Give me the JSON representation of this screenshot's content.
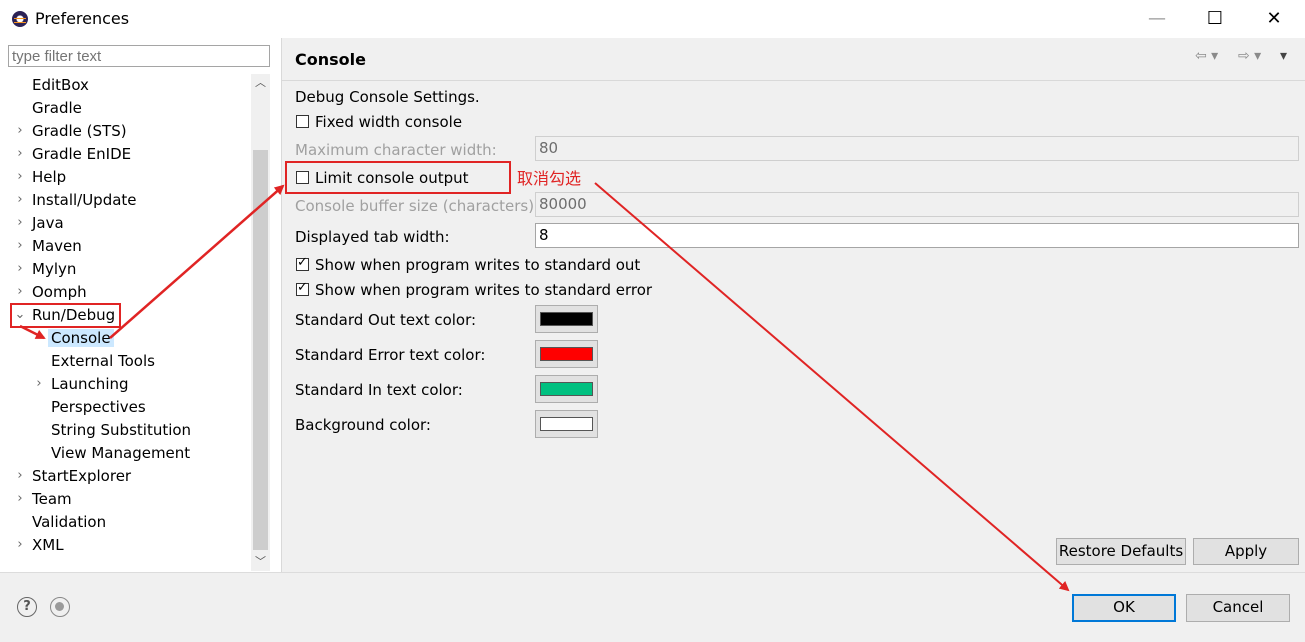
{
  "window": {
    "title": "Preferences",
    "minimize": "—",
    "maximize": "☐",
    "close": "✕"
  },
  "filter": {
    "placeholder": "type filter text"
  },
  "tree": {
    "items": [
      {
        "label": "EditBox",
        "twisty": ""
      },
      {
        "label": "Gradle",
        "twisty": ""
      },
      {
        "label": "Gradle (STS)",
        "twisty": "›"
      },
      {
        "label": "Gradle EnIDE",
        "twisty": "›"
      },
      {
        "label": "Help",
        "twisty": "›"
      },
      {
        "label": "Install/Update",
        "twisty": "›"
      },
      {
        "label": "Java",
        "twisty": "›"
      },
      {
        "label": "Maven",
        "twisty": "›"
      },
      {
        "label": "Mylyn",
        "twisty": "›"
      },
      {
        "label": "Oomph",
        "twisty": "›"
      },
      {
        "label": "Run/Debug",
        "twisty": "⌄"
      },
      {
        "label": "Console",
        "twisty": ""
      },
      {
        "label": "External Tools",
        "twisty": ""
      },
      {
        "label": "Launching",
        "twisty": "›"
      },
      {
        "label": "Perspectives",
        "twisty": ""
      },
      {
        "label": "String Substitution",
        "twisty": ""
      },
      {
        "label": "View Management",
        "twisty": ""
      },
      {
        "label": "StartExplorer",
        "twisty": "›"
      },
      {
        "label": "Team",
        "twisty": "›"
      },
      {
        "label": "Validation",
        "twisty": ""
      },
      {
        "label": "XML",
        "twisty": "›"
      }
    ]
  },
  "page": {
    "title": "Console",
    "section": "Debug Console Settings.",
    "fixed_width": {
      "label": "Fixed width console",
      "checked": false
    },
    "max_char_width": {
      "label": "Maximum character width:",
      "value": "80"
    },
    "limit_output": {
      "label": "Limit console output",
      "checked": false
    },
    "buffer_size": {
      "label": "Console buffer size (characters):",
      "value": "80000"
    },
    "tab_width": {
      "label": "Displayed tab width:",
      "value": "8"
    },
    "show_stdout": {
      "label": "Show when program writes to standard out",
      "checked": true
    },
    "show_stderr": {
      "label": "Show when program writes to standard error",
      "checked": true
    },
    "colors": [
      {
        "label": "Standard Out text color:",
        "color": "#000000"
      },
      {
        "label": "Standard Error text color:",
        "color": "#ff0000"
      },
      {
        "label": "Standard In text color:",
        "color": "#00c080"
      },
      {
        "label": "Background color:",
        "color": "#ffffff"
      }
    ],
    "restore_defaults": "Restore Defaults",
    "apply": "Apply"
  },
  "footer": {
    "ok": "OK",
    "cancel": "Cancel"
  },
  "annotation": {
    "text": "取消勾选",
    "color": "#e02424"
  }
}
